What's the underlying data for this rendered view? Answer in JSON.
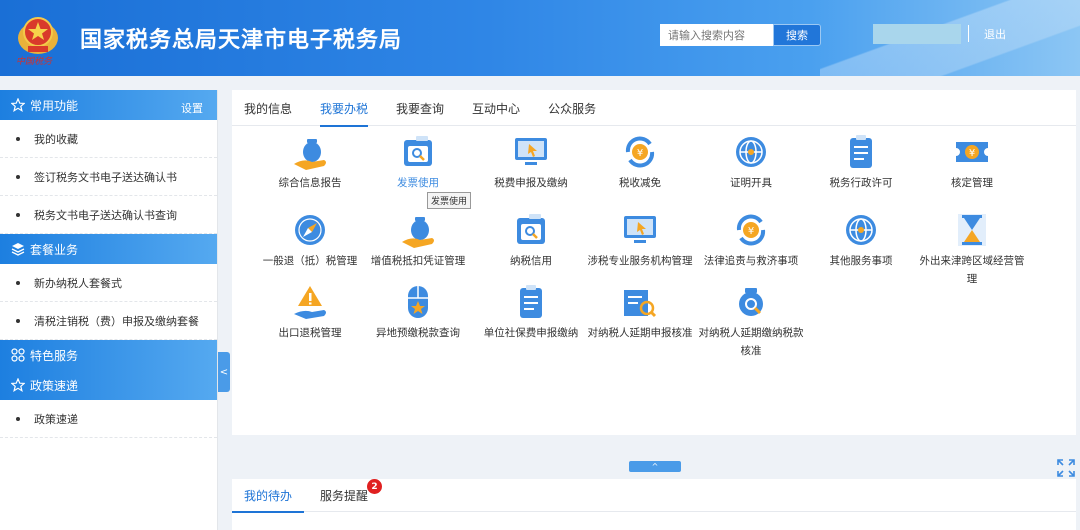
{
  "header": {
    "title": "国家税务总局天津市电子税务局",
    "emblem_caption": "中国税务",
    "search_placeholder": "请输入搜索内容",
    "search_button": "搜索",
    "logout": "退出"
  },
  "sidebar": {
    "sections": [
      {
        "title": "常用功能",
        "icon": "star-icon",
        "action": "设置",
        "items": [
          "我的收藏",
          "签订税务文书电子送达确认书",
          "税务文书电子送达确认书查询"
        ]
      },
      {
        "title": "套餐业务",
        "icon": "layers-icon",
        "items": [
          "新办纳税人套餐式",
          "清税注销税（费）申报及缴纳套餐"
        ]
      },
      {
        "title": "特色服务",
        "icon": "grid-icon",
        "items": []
      },
      {
        "title": "政策速递",
        "icon": "star-icon",
        "items": [
          "政策速递"
        ]
      }
    ],
    "collapse_glyph": "<"
  },
  "main": {
    "tabs": [
      "我的信息",
      "我要办税",
      "我要查询",
      "互动中心",
      "公众服务"
    ],
    "active_tab": 1,
    "functions": [
      {
        "label": "综合信息报告",
        "icon": "money-bag-hand-icon"
      },
      {
        "label": "发票使用",
        "icon": "invoice-search-icon"
      },
      {
        "label": "税费申报及缴纳",
        "icon": "monitor-cursor-icon"
      },
      {
        "label": "税收减免",
        "icon": "yuan-refresh-icon"
      },
      {
        "label": "证明开具",
        "icon": "globe-icon"
      },
      {
        "label": "税务行政许可",
        "icon": "clipboard-list-icon"
      },
      {
        "label": "核定管理",
        "icon": "yuan-ticket-icon"
      },
      {
        "label": "一般退（抵）税管理",
        "icon": "compass-icon"
      },
      {
        "label": "增值税抵扣凭证管理",
        "icon": "money-bag-hand-icon"
      },
      {
        "label": "纳税信用",
        "icon": "invoice-search-icon"
      },
      {
        "label": "涉税专业服务机构管理",
        "icon": "monitor-cursor-icon"
      },
      {
        "label": "法律追责与救济事项",
        "icon": "yuan-refresh-icon"
      },
      {
        "label": "其他服务事项",
        "icon": "globe-icon"
      },
      {
        "label": "外出来津跨区域经营管理",
        "icon": "hourglass-icon"
      },
      {
        "label": "出口退税管理",
        "icon": "warning-hand-icon"
      },
      {
        "label": "异地预缴税款查询",
        "icon": "mouse-star-icon"
      },
      {
        "label": "单位社保费申报缴纳",
        "icon": "clipboard-list-icon"
      },
      {
        "label": "对纳税人延期申报核准",
        "icon": "document-search-icon"
      },
      {
        "label": "对纳税人延期缴纳税款核准",
        "icon": "money-bag-search-icon"
      }
    ],
    "hovered_index": 1,
    "tooltip": "发票使用",
    "expand_glyph": "^"
  },
  "bottom": {
    "tabs": [
      "我的待办",
      "服务提醒"
    ],
    "active_tab": 0,
    "reminder_count": "2"
  },
  "colors": {
    "accent": "#1e74d6",
    "header": "#2f86e6",
    "badge": "#e02020",
    "icon_orange": "#f5a623"
  }
}
